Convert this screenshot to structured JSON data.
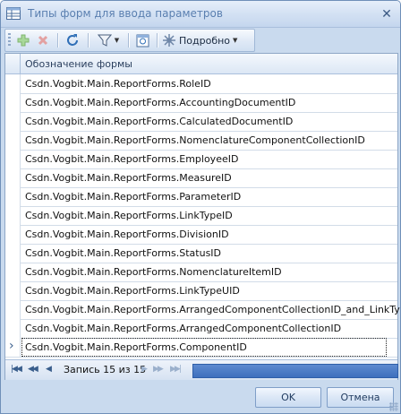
{
  "window": {
    "title": "Типы форм для ввода параметров",
    "close_symbol": "✕"
  },
  "toolbar": {
    "details_label": "Подробно",
    "icons": [
      "add-icon",
      "delete-icon",
      "refresh-icon",
      "filter-icon",
      "form-view-icon",
      "details-icon"
    ]
  },
  "grid": {
    "column_header": "Обозначение формы",
    "rows": [
      "Csdn.Vogbit.Main.ReportForms.RoleID",
      "Csdn.Vogbit.Main.ReportForms.AccountingDocumentID",
      "Csdn.Vogbit.Main.ReportForms.CalculatedDocumentID",
      "Csdn.Vogbit.Main.ReportForms.NomenclatureComponentCollectionID",
      "Csdn.Vogbit.Main.ReportForms.EmployeeID",
      "Csdn.Vogbit.Main.ReportForms.MeasureID",
      "Csdn.Vogbit.Main.ReportForms.ParameterID",
      "Csdn.Vogbit.Main.ReportForms.LinkTypeID",
      "Csdn.Vogbit.Main.ReportForms.DivisionID",
      "Csdn.Vogbit.Main.ReportForms.StatusID",
      "Csdn.Vogbit.Main.ReportForms.NomenclatureItemID",
      "Csdn.Vogbit.Main.ReportForms.LinkTypeUID",
      "Csdn.Vogbit.Main.ReportForms.ArrangedComponentCollectionID_and_LinkTypeID",
      "Csdn.Vogbit.Main.ReportForms.ArrangedComponentCollectionID",
      "Csdn.Vogbit.Main.ReportForms.ComponentID"
    ],
    "current_row": 15,
    "navigator_text": "Запись 15 из 15"
  },
  "buttons": {
    "ok": "OK",
    "cancel": "Отмена"
  },
  "colors": {
    "accent": "#3e6fbd",
    "title_text": "#5a7fb0",
    "frame": "#c9daee"
  }
}
